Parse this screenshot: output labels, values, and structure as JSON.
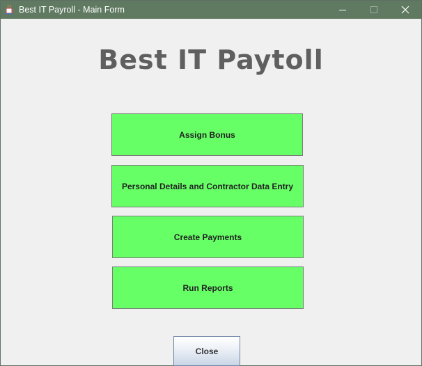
{
  "window": {
    "title": "Best IT Payroll - Main Form",
    "icons": {
      "app": "java-cup-icon",
      "minimize": "minimize-icon",
      "maximize": "maximize-icon",
      "close": "close-icon"
    }
  },
  "main": {
    "heading": "Best IT Paytoll",
    "buttons": {
      "assign_bonus": "Assign Bonus",
      "personal_details": "Personal Details and Contractor Data Entry",
      "create_payments": "Create Payments",
      "run_reports": "Run Reports",
      "close": "Close"
    }
  },
  "colors": {
    "titlebar": "#607a62",
    "window_bg": "#f0f0f0",
    "green_button": "#66ff66",
    "heading_text": "#5f5f5f"
  }
}
